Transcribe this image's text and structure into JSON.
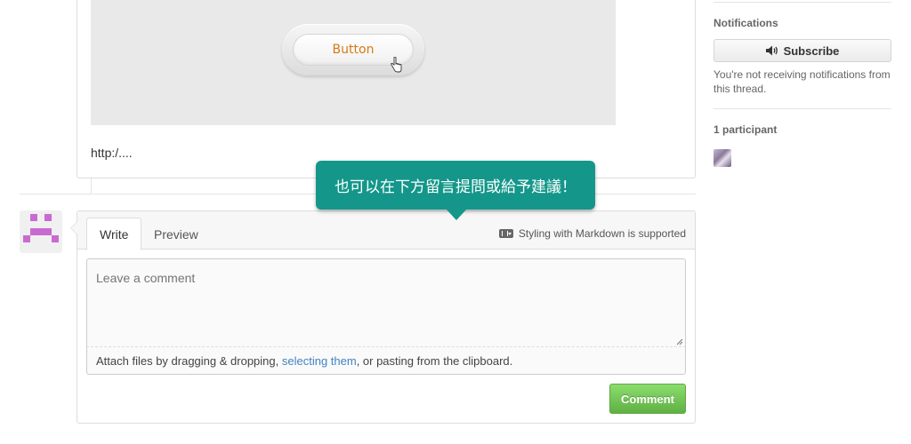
{
  "previous_comment": {
    "embedded_button_label": "Button",
    "link_text": "http:/...."
  },
  "tooltip": {
    "text": "也可以在下方留言提問或給予建議！"
  },
  "comment_form": {
    "tabs": [
      {
        "label": "Write",
        "active": true
      },
      {
        "label": "Preview",
        "active": false
      }
    ],
    "markdown_note": "Styling with Markdown is supported",
    "textarea_placeholder": "Leave a comment",
    "attach_prefix": "Attach files by dragging & dropping, ",
    "attach_link": "selecting them",
    "attach_suffix": ", or pasting from the clipboard.",
    "submit_label": "Comment",
    "submit_color": "#6cc644"
  },
  "sidebar": {
    "notifications_heading": "Notifications",
    "subscribe_label": "Subscribe",
    "notify_text": "You're not receiving notifications from this thread.",
    "participants_heading": "1 participant"
  },
  "colors": {
    "tooltip_bg": "#14978a",
    "avatar_identicon": "#c86bd1",
    "link": "#4183c4",
    "embedded_button_text": "#d67a16"
  },
  "icons": [
    "hand-cursor-icon",
    "markdown-icon",
    "resize-handle-icon",
    "speaker-icon"
  ]
}
